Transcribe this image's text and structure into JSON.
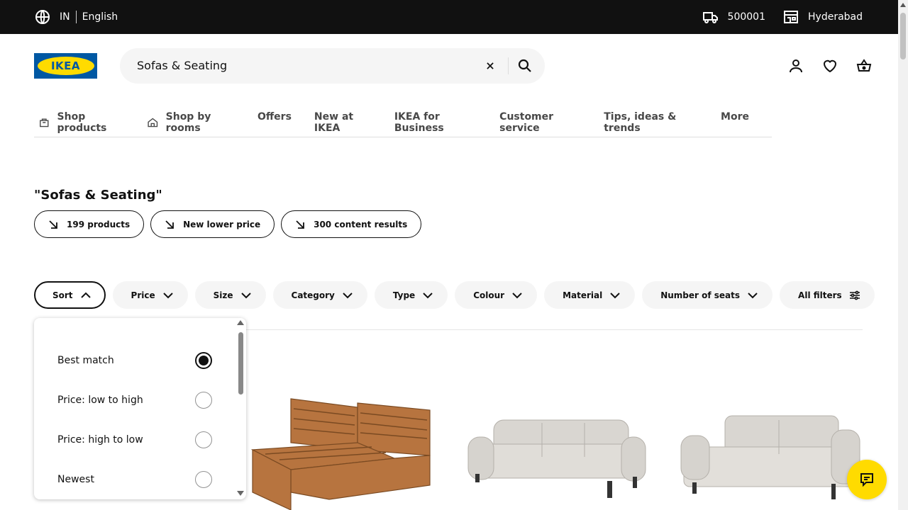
{
  "topbar": {
    "country": "IN",
    "language": "English",
    "pincode": "500001",
    "store": "Hyderabad"
  },
  "header": {
    "logo_text": "IKEA",
    "search_query": "Sofas & Seating"
  },
  "nav": {
    "items": [
      {
        "label": "Shop products"
      },
      {
        "label": "Shop by rooms"
      },
      {
        "label": "Offers"
      },
      {
        "label": "New at IKEA"
      },
      {
        "label": "IKEA for Business"
      },
      {
        "label": "Customer service"
      },
      {
        "label": "Tips, ideas & trends"
      },
      {
        "label": "More"
      }
    ]
  },
  "results": {
    "title": "\"Sofas & Seating\"",
    "pills": [
      {
        "label": "199 products"
      },
      {
        "label": "New lower price"
      },
      {
        "label": "300 content results"
      }
    ]
  },
  "filters": {
    "items": [
      {
        "label": "Sort"
      },
      {
        "label": "Price"
      },
      {
        "label": "Size"
      },
      {
        "label": "Category"
      },
      {
        "label": "Type"
      },
      {
        "label": "Colour"
      },
      {
        "label": "Material"
      },
      {
        "label": "Number of seats"
      },
      {
        "label": "All filters"
      }
    ]
  },
  "sort": {
    "options": [
      {
        "label": "Best match",
        "selected": true
      },
      {
        "label": "Price: low to high",
        "selected": false
      },
      {
        "label": "Price: high to low",
        "selected": false
      },
      {
        "label": "Newest",
        "selected": false
      }
    ]
  },
  "colors": {
    "brand_blue": "#0058a3",
    "brand_yellow": "#ffdb00",
    "topbar_bg": "#111111"
  }
}
